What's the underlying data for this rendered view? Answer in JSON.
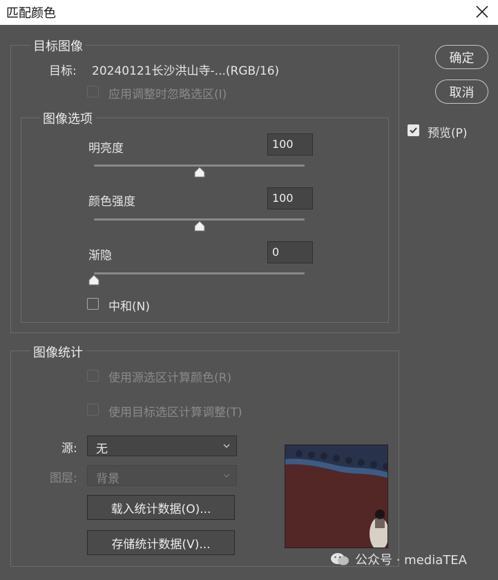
{
  "window": {
    "title": "匹配颜色",
    "close_icon": "close-icon"
  },
  "target": {
    "legend": "目标图像",
    "label": "目标:",
    "value": "20240121长沙洪山寺-...(RGB/16)",
    "ignore_selection_label": "应用调整时忽略选区(I)"
  },
  "image_options": {
    "legend": "图像选项",
    "luminance": {
      "label": "明亮度",
      "value": "100",
      "slider_fraction": 0.5
    },
    "color_intensity": {
      "label": "颜色强度",
      "value": "100",
      "slider_fraction": 0.5
    },
    "fade": {
      "label": "渐隐",
      "value": "0",
      "slider_fraction": 0.0
    },
    "neutralize_label": "中和(N)"
  },
  "buttons": {
    "ok": "确定",
    "cancel": "取消",
    "preview_label": "预览(P)"
  },
  "image_statistics": {
    "legend": "图像统计",
    "use_source_selection": "使用源选区计算颜色(R)",
    "use_target_selection": "使用目标选区计算调整(T)",
    "source_label": "源:",
    "source_value": "无",
    "layer_label": "图层:",
    "layer_value": "背景",
    "load_stats": "载入统计数据(O)...",
    "save_stats": "存储统计数据(V)..."
  },
  "watermark": "公众号 · mediaTEA",
  "colors": {
    "dialog_bg": "#535353",
    "titlebar_bg": "#ffffff",
    "text": "#e6e6e6",
    "disabled_text": "#8a8a8a"
  }
}
